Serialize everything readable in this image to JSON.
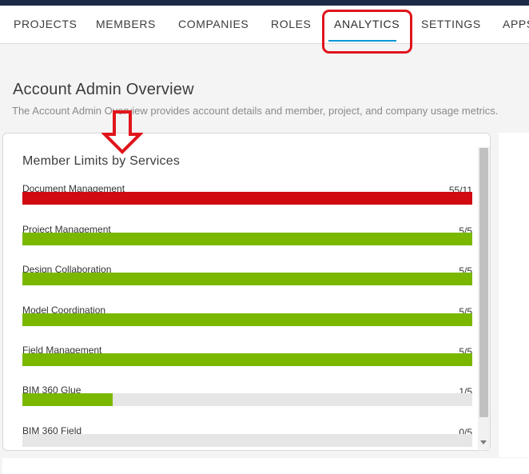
{
  "nav": {
    "tabs": [
      {
        "label": "PROJECTS"
      },
      {
        "label": "MEMBERS"
      },
      {
        "label": "COMPANIES"
      },
      {
        "label": "ROLES"
      },
      {
        "label": "ANALYTICS",
        "active": true
      },
      {
        "label": "SETTINGS"
      },
      {
        "label": "APPS"
      }
    ]
  },
  "page": {
    "title": "Account Admin Overview",
    "subtitle": "The Account Admin Overview provides account details and member, project, and company usage metrics."
  },
  "card": {
    "title": "Member Limits by Services",
    "services": [
      {
        "name": "Document Management",
        "value_text": "55/11",
        "fraction": 1.0,
        "color": "#d10a11"
      },
      {
        "name": "Project Management",
        "value_text": "5/5",
        "fraction": 1.0,
        "color": "#7ab800"
      },
      {
        "name": "Design Collaboration",
        "value_text": "5/5",
        "fraction": 1.0,
        "color": "#7ab800"
      },
      {
        "name": "Model Coordination",
        "value_text": "5/5",
        "fraction": 1.0,
        "color": "#7ab800"
      },
      {
        "name": "Field Management",
        "value_text": "5/5",
        "fraction": 1.0,
        "color": "#7ab800"
      },
      {
        "name": "BIM 360 Glue",
        "value_text": "1/5",
        "fraction": 0.2,
        "color": "#7ab800"
      },
      {
        "name": "BIM 360 Field",
        "value_text": "0/5",
        "fraction": 0.0,
        "color": "#7ab800"
      }
    ]
  },
  "colors": {
    "accent": "#0696d7",
    "over_limit": "#d10a11",
    "ok": "#7ab800",
    "annotation": "#e0151c"
  }
}
